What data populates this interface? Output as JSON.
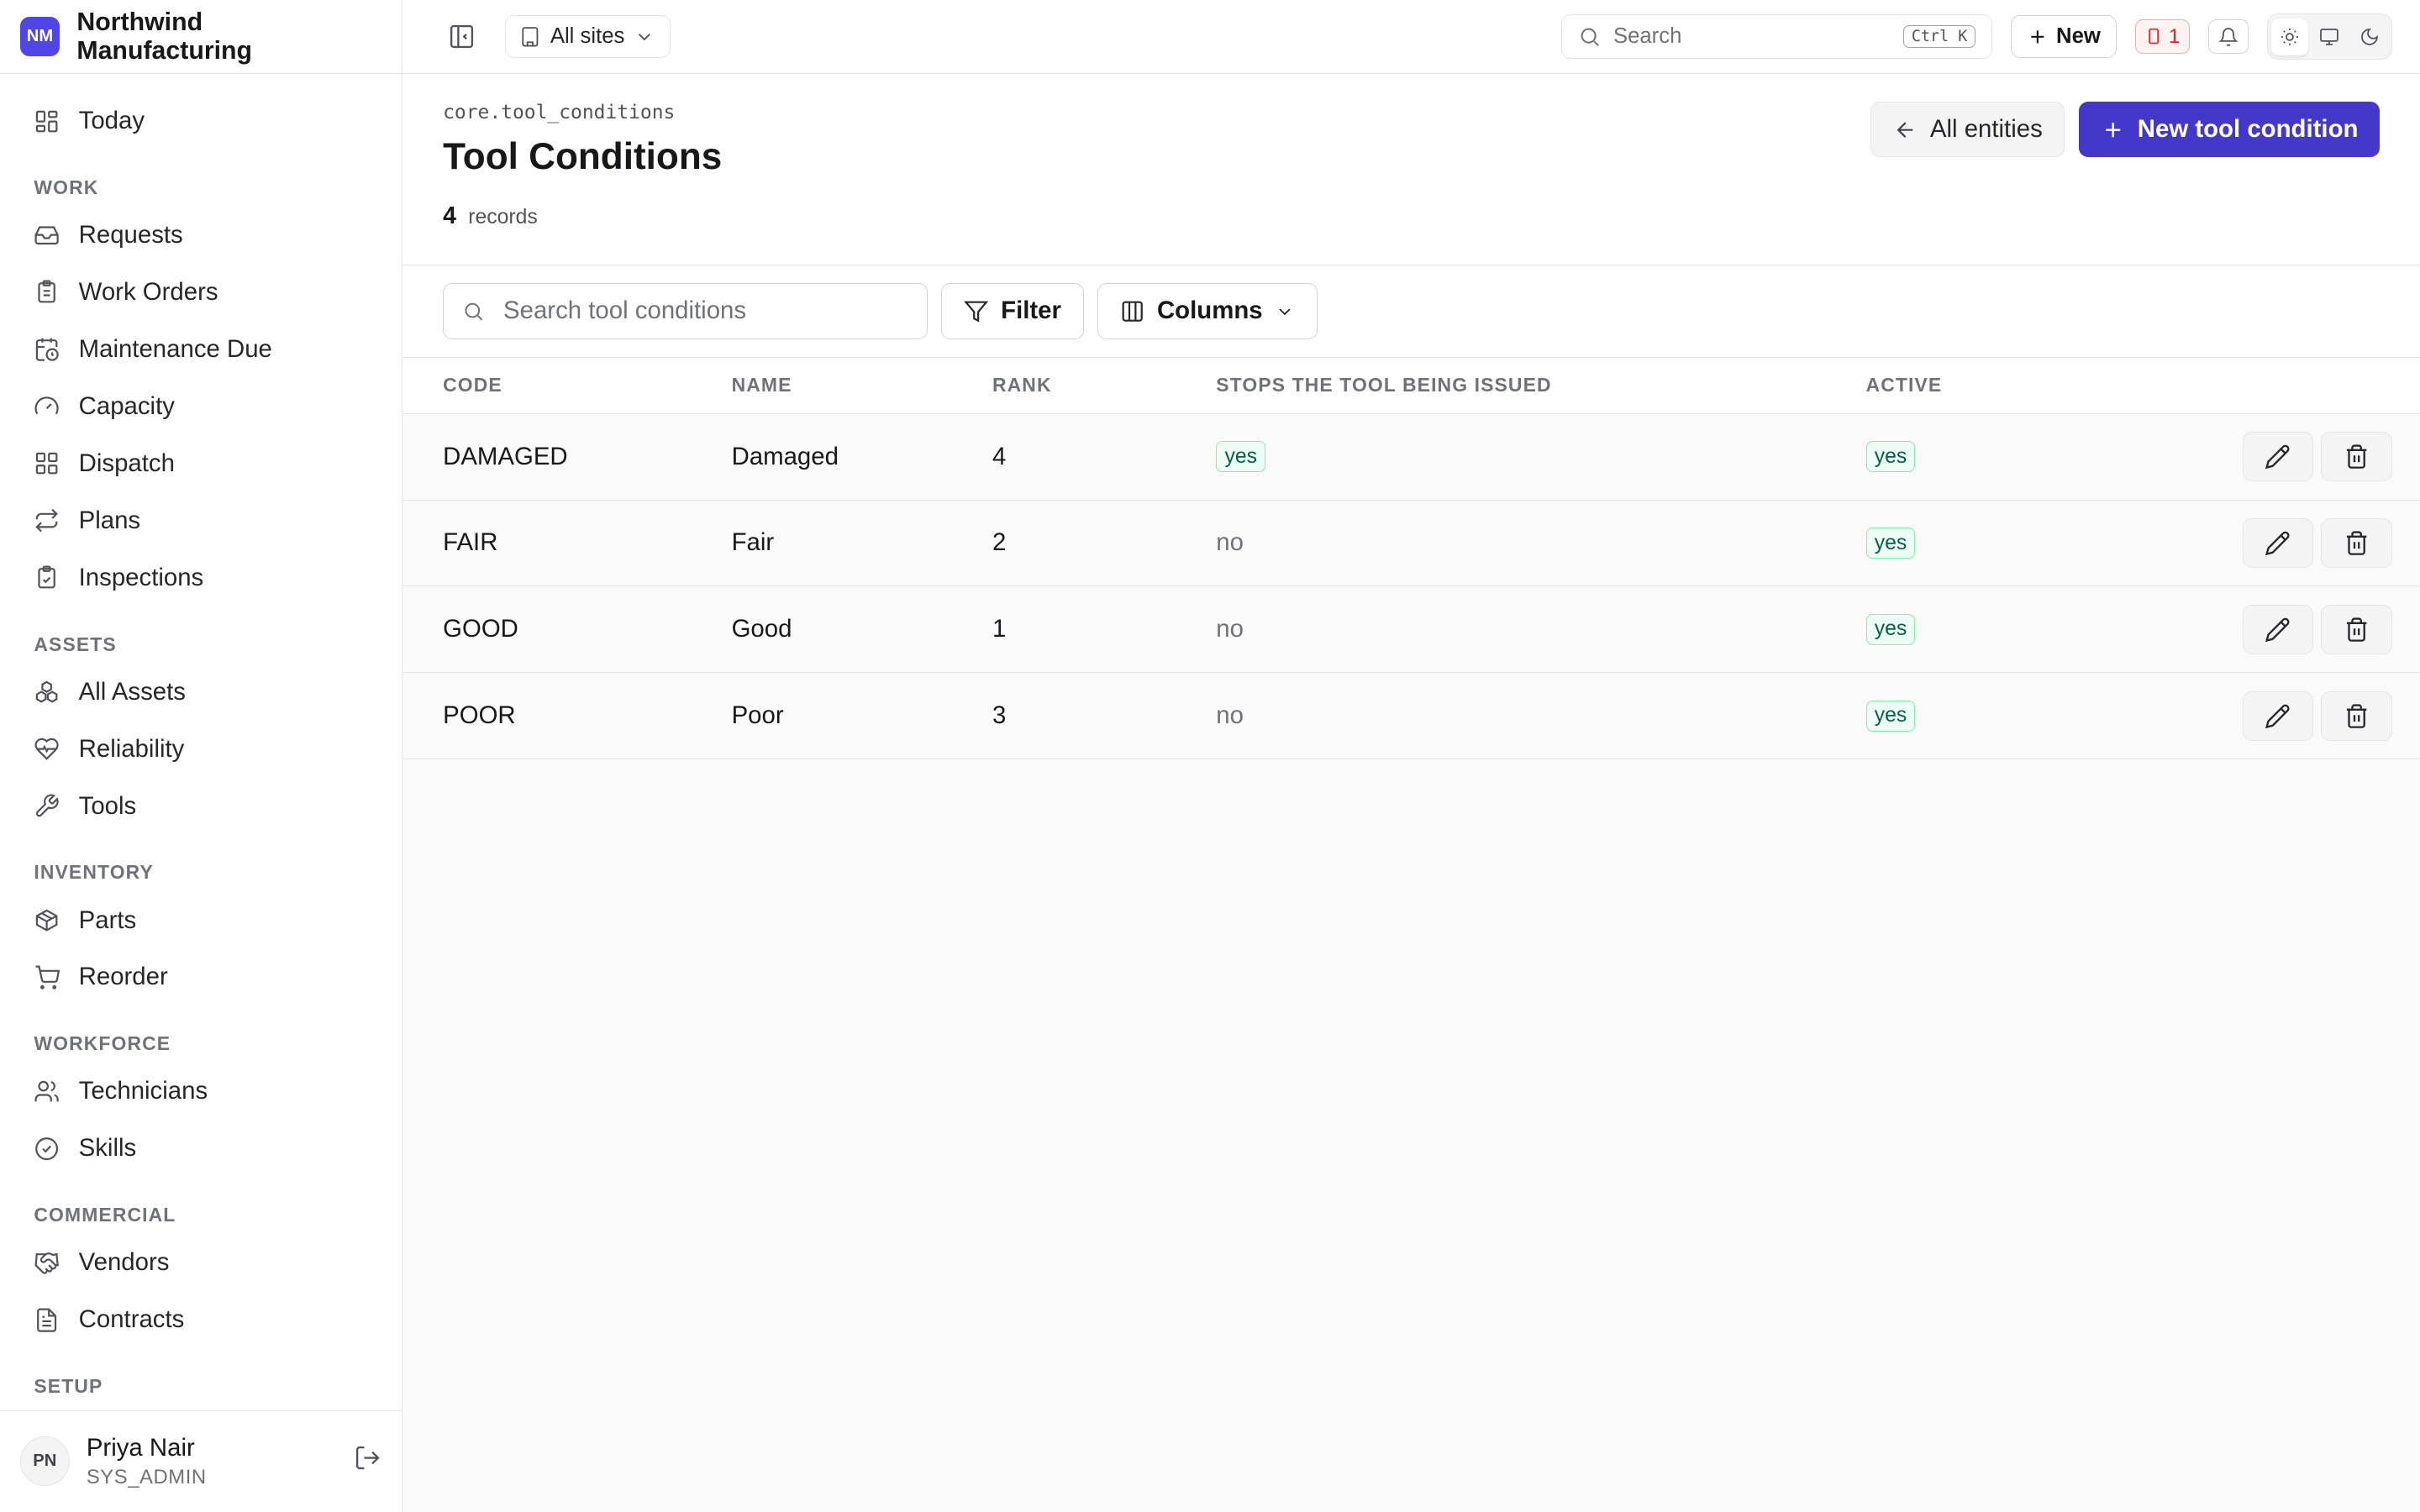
{
  "brand": {
    "initials": "NM",
    "name": "Northwind Manufacturing",
    "accent": "#4f46e5"
  },
  "nav": {
    "top": [
      {
        "label": "Today",
        "icon": "dashboard-icon"
      }
    ],
    "sections": [
      {
        "title": "WORK",
        "items": [
          {
            "label": "Requests",
            "icon": "inbox-icon"
          },
          {
            "label": "Work Orders",
            "icon": "clipboard-icon"
          },
          {
            "label": "Maintenance Due",
            "icon": "calendar-clock-icon"
          },
          {
            "label": "Capacity",
            "icon": "gauge-icon"
          },
          {
            "label": "Dispatch",
            "icon": "grid-icon"
          },
          {
            "label": "Plans",
            "icon": "repeat-icon"
          },
          {
            "label": "Inspections",
            "icon": "clipboard-check-icon"
          }
        ]
      },
      {
        "title": "ASSETS",
        "items": [
          {
            "label": "All Assets",
            "icon": "boxes-icon"
          },
          {
            "label": "Reliability",
            "icon": "heart-pulse-icon"
          },
          {
            "label": "Tools",
            "icon": "wrench-icon"
          }
        ]
      },
      {
        "title": "INVENTORY",
        "items": [
          {
            "label": "Parts",
            "icon": "package-icon"
          },
          {
            "label": "Reorder",
            "icon": "cart-icon"
          }
        ]
      },
      {
        "title": "WORKFORCE",
        "items": [
          {
            "label": "Technicians",
            "icon": "users-icon"
          },
          {
            "label": "Skills",
            "icon": "badge-check-icon"
          }
        ]
      },
      {
        "title": "COMMERCIAL",
        "items": [
          {
            "label": "Vendors",
            "icon": "handshake-icon"
          },
          {
            "label": "Contracts",
            "icon": "file-text-icon"
          }
        ]
      },
      {
        "title": "SETUP",
        "items": []
      }
    ]
  },
  "user": {
    "initials": "PN",
    "name": "Priya Nair",
    "role": "SYS_ADMIN"
  },
  "topbar": {
    "site": "All sites",
    "search_placeholder": "Search",
    "search_shortcut": "Ctrl K",
    "new_label": "New",
    "alert_count": "1"
  },
  "page": {
    "entity_key": "core.tool_conditions",
    "title": "Tool Conditions",
    "record_count": "4",
    "record_label": "records",
    "back_label": "All entities",
    "create_label": "New tool condition"
  },
  "toolbar": {
    "search_placeholder": "Search tool conditions",
    "filter_label": "Filter",
    "columns_label": "Columns"
  },
  "table": {
    "columns": [
      "CODE",
      "NAME",
      "RANK",
      "STOPS THE TOOL BEING ISSUED",
      "ACTIVE"
    ],
    "rows": [
      {
        "code": "DAMAGED",
        "name": "Damaged",
        "rank": "4",
        "stops": "yes",
        "active": "yes"
      },
      {
        "code": "FAIR",
        "name": "Fair",
        "rank": "2",
        "stops": "no",
        "active": "yes"
      },
      {
        "code": "GOOD",
        "name": "Good",
        "rank": "1",
        "stops": "no",
        "active": "yes"
      },
      {
        "code": "POOR",
        "name": "Poor",
        "rank": "3",
        "stops": "no",
        "active": "yes"
      }
    ]
  },
  "colors": {
    "primary": "#4338ca",
    "success_bg": "#ecfdf5",
    "success_text": "#065f46",
    "danger": "#dc2626"
  }
}
